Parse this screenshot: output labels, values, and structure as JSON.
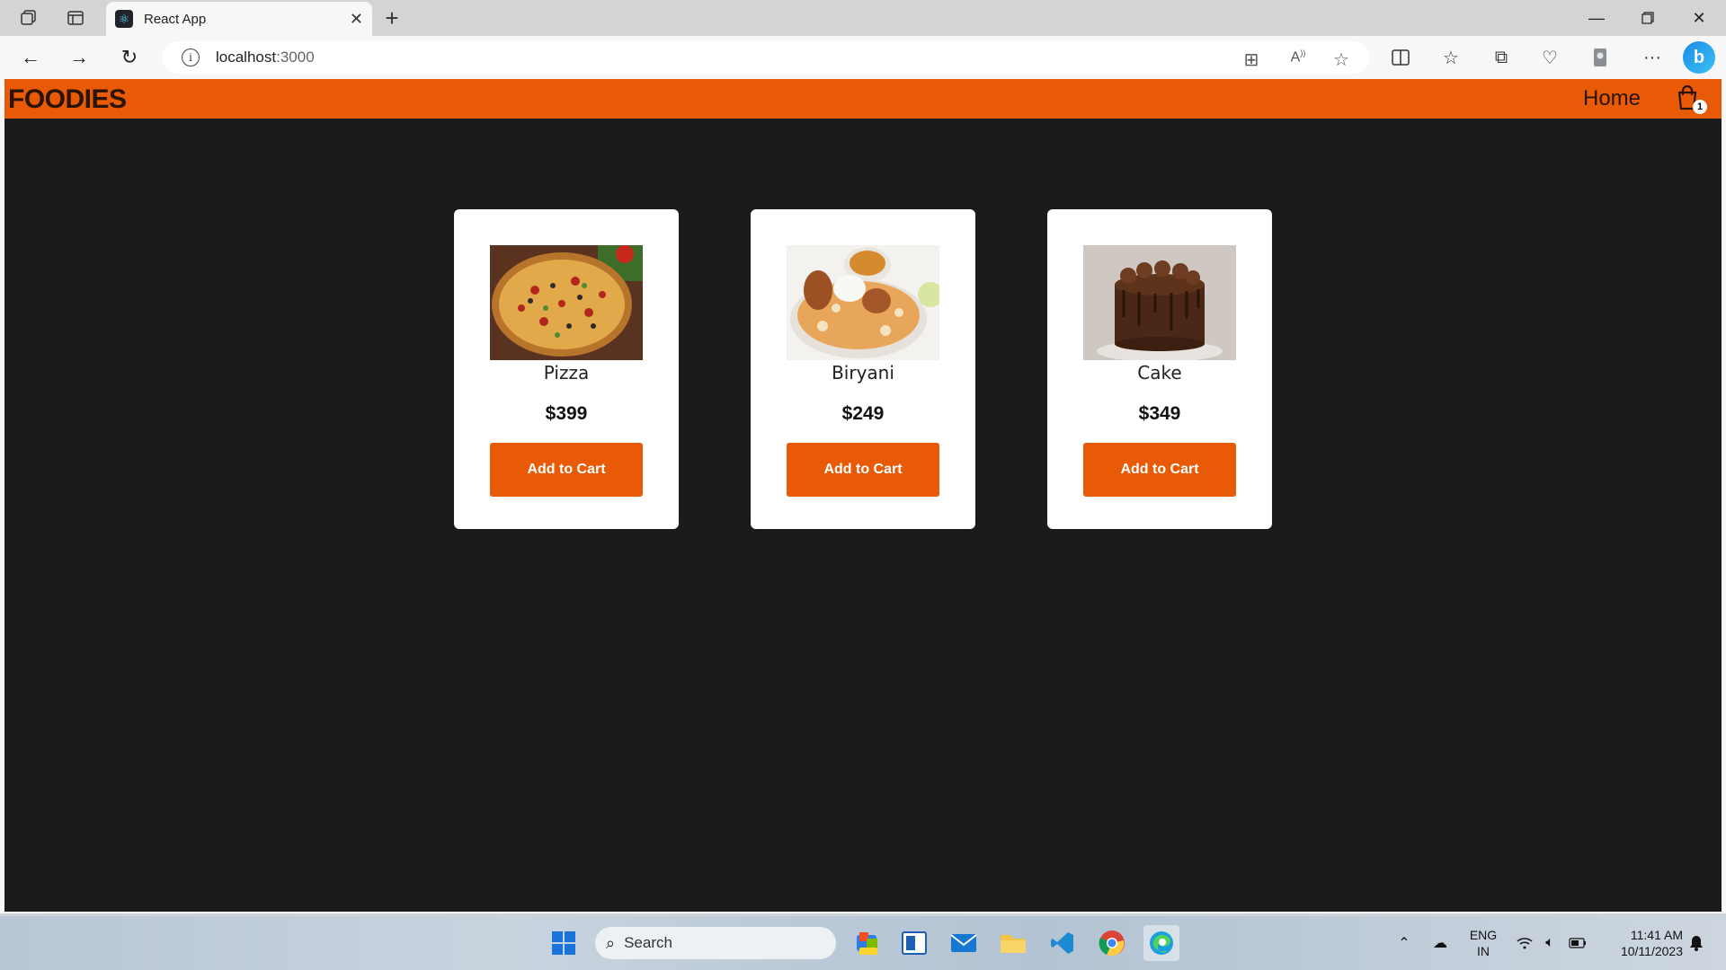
{
  "browser": {
    "tab_title": "React App",
    "url_host": "localhost",
    "url_port": ":3000"
  },
  "app": {
    "brand": "FOODIES",
    "nav_home": "Home",
    "cart_count": "1",
    "products": [
      {
        "name": "Pizza",
        "price": "$399",
        "button": "Add to Cart"
      },
      {
        "name": "Biryani",
        "price": "$249",
        "button": "Add to Cart"
      },
      {
        "name": "Cake",
        "price": "$349",
        "button": "Add to Cart"
      }
    ]
  },
  "taskbar": {
    "search_label": "Search",
    "lang_line1": "ENG",
    "lang_line2": "IN",
    "time": "11:41 AM",
    "date": "10/11/2023"
  },
  "colors": {
    "accent": "#e85a05",
    "background": "#1b1b1b",
    "card": "#ffffff"
  }
}
